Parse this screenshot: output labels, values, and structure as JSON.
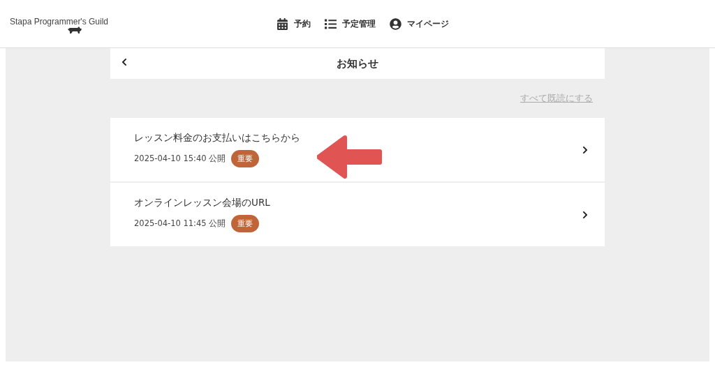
{
  "header": {
    "logo": "Stapa Programmer's Guild",
    "nav": [
      {
        "kind": "calendar",
        "label": "予約"
      },
      {
        "kind": "list",
        "label": "予定管理"
      },
      {
        "kind": "user",
        "label": "マイページ"
      }
    ]
  },
  "page": {
    "title": "お知らせ",
    "mark_all_read": "すべて既読にする"
  },
  "notices": [
    {
      "title": "レッスン料金のお支払いはこちらから",
      "date": "2025-04-10 15:40 公開",
      "badge": "重要",
      "annotated": true
    },
    {
      "title": "オンラインレッスン会場のURL",
      "date": "2025-04-10 11:45 公開",
      "badge": "重要",
      "annotated": false
    }
  ]
}
